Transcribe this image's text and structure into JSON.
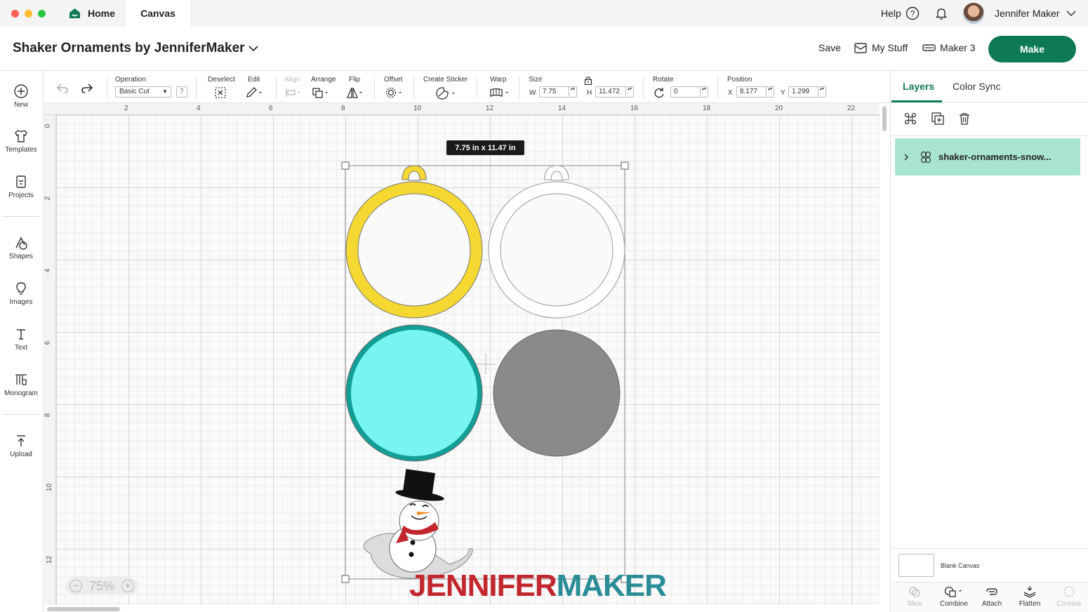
{
  "tabs": {
    "home": "Home",
    "canvas": "Canvas"
  },
  "top_right": {
    "help": "Help",
    "user_name": "Jennifer Maker"
  },
  "header": {
    "project_title": "Shaker Ornaments by JenniferMaker",
    "save": "Save",
    "my_stuff": "My Stuff",
    "machine": "Maker 3",
    "make": "Make"
  },
  "sidebar": [
    {
      "label": "New",
      "icon": "plus-circle-icon"
    },
    {
      "label": "Templates",
      "icon": "shirt-icon"
    },
    {
      "label": "Projects",
      "icon": "projects-icon"
    },
    {
      "label": "Shapes",
      "icon": "shapes-icon"
    },
    {
      "label": "Images",
      "icon": "lightbulb-icon"
    },
    {
      "label": "Text",
      "icon": "text-icon"
    },
    {
      "label": "Monogram",
      "icon": "monogram-icon"
    },
    {
      "label": "Upload",
      "icon": "upload-icon"
    }
  ],
  "toolbar": {
    "operation_label": "Operation",
    "operation_value": "Basic Cut",
    "help_glyph": "?",
    "deselect": "Deselect",
    "edit": "Edit",
    "align": "Align",
    "arrange": "Arrange",
    "flip": "Flip",
    "offset": "Offset",
    "create_sticker": "Create Sticker",
    "warp": "Warp",
    "size": "Size",
    "w_label": "W",
    "w_value": "7.75",
    "h_label": "H",
    "h_value": "11.472",
    "rotate": "Rotate",
    "rotate_value": "0",
    "position": "Position",
    "x_label": "X",
    "x_value": "8.177",
    "y_label": "Y",
    "y_value": "1.299"
  },
  "ruler": {
    "top": [
      "2",
      "4",
      "6",
      "8",
      "10",
      "12",
      "14",
      "16",
      "18",
      "20",
      "22"
    ],
    "left": [
      "0",
      "2",
      "4",
      "6",
      "8",
      "10",
      "12"
    ]
  },
  "canvas": {
    "size_tooltip": "7.75  in x 11.47  in",
    "zoom": "75%",
    "watermark_a": "JENNIFER",
    "watermark_b": "MAKER",
    "colors": {
      "yellow": "#f5d832",
      "teal": "#139e96",
      "aqua": "#78f5f0",
      "gray": "#8a8a8a"
    }
  },
  "right_panel": {
    "tab_layers": "Layers",
    "tab_color_sync": "Color Sync",
    "layer_name": "shaker-ornaments-snow...",
    "blank_canvas": "Blank Canvas",
    "bottom_tools": [
      {
        "label": "Slice",
        "enabled": false
      },
      {
        "label": "Combine",
        "enabled": true
      },
      {
        "label": "Attach",
        "enabled": true
      },
      {
        "label": "Flatten",
        "enabled": true
      },
      {
        "label": "Contour",
        "enabled": false
      }
    ]
  }
}
